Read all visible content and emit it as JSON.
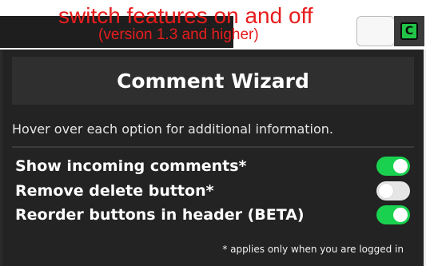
{
  "annotation": {
    "title": "switch features on and off",
    "subtitle": "(version 1.3 and higher)"
  },
  "extension_icon": {
    "name": "comment-wizard-icon",
    "glyph": "C",
    "color": "#21c447"
  },
  "popup": {
    "title": "Comment Wizard",
    "hint": "Hover over each option for additional information.",
    "options": [
      {
        "label": "Show incoming comments*",
        "enabled": true
      },
      {
        "label": "Remove delete button*",
        "enabled": false
      },
      {
        "label": "Reorder buttons in header (BETA)",
        "enabled": true
      }
    ],
    "footnote": "* applies only when you are logged in"
  },
  "colors": {
    "accent_on": "#1ad14f",
    "toggle_off": "#e6e6e6",
    "annotation": "#e81d1d",
    "popup_bg": "#232323"
  }
}
